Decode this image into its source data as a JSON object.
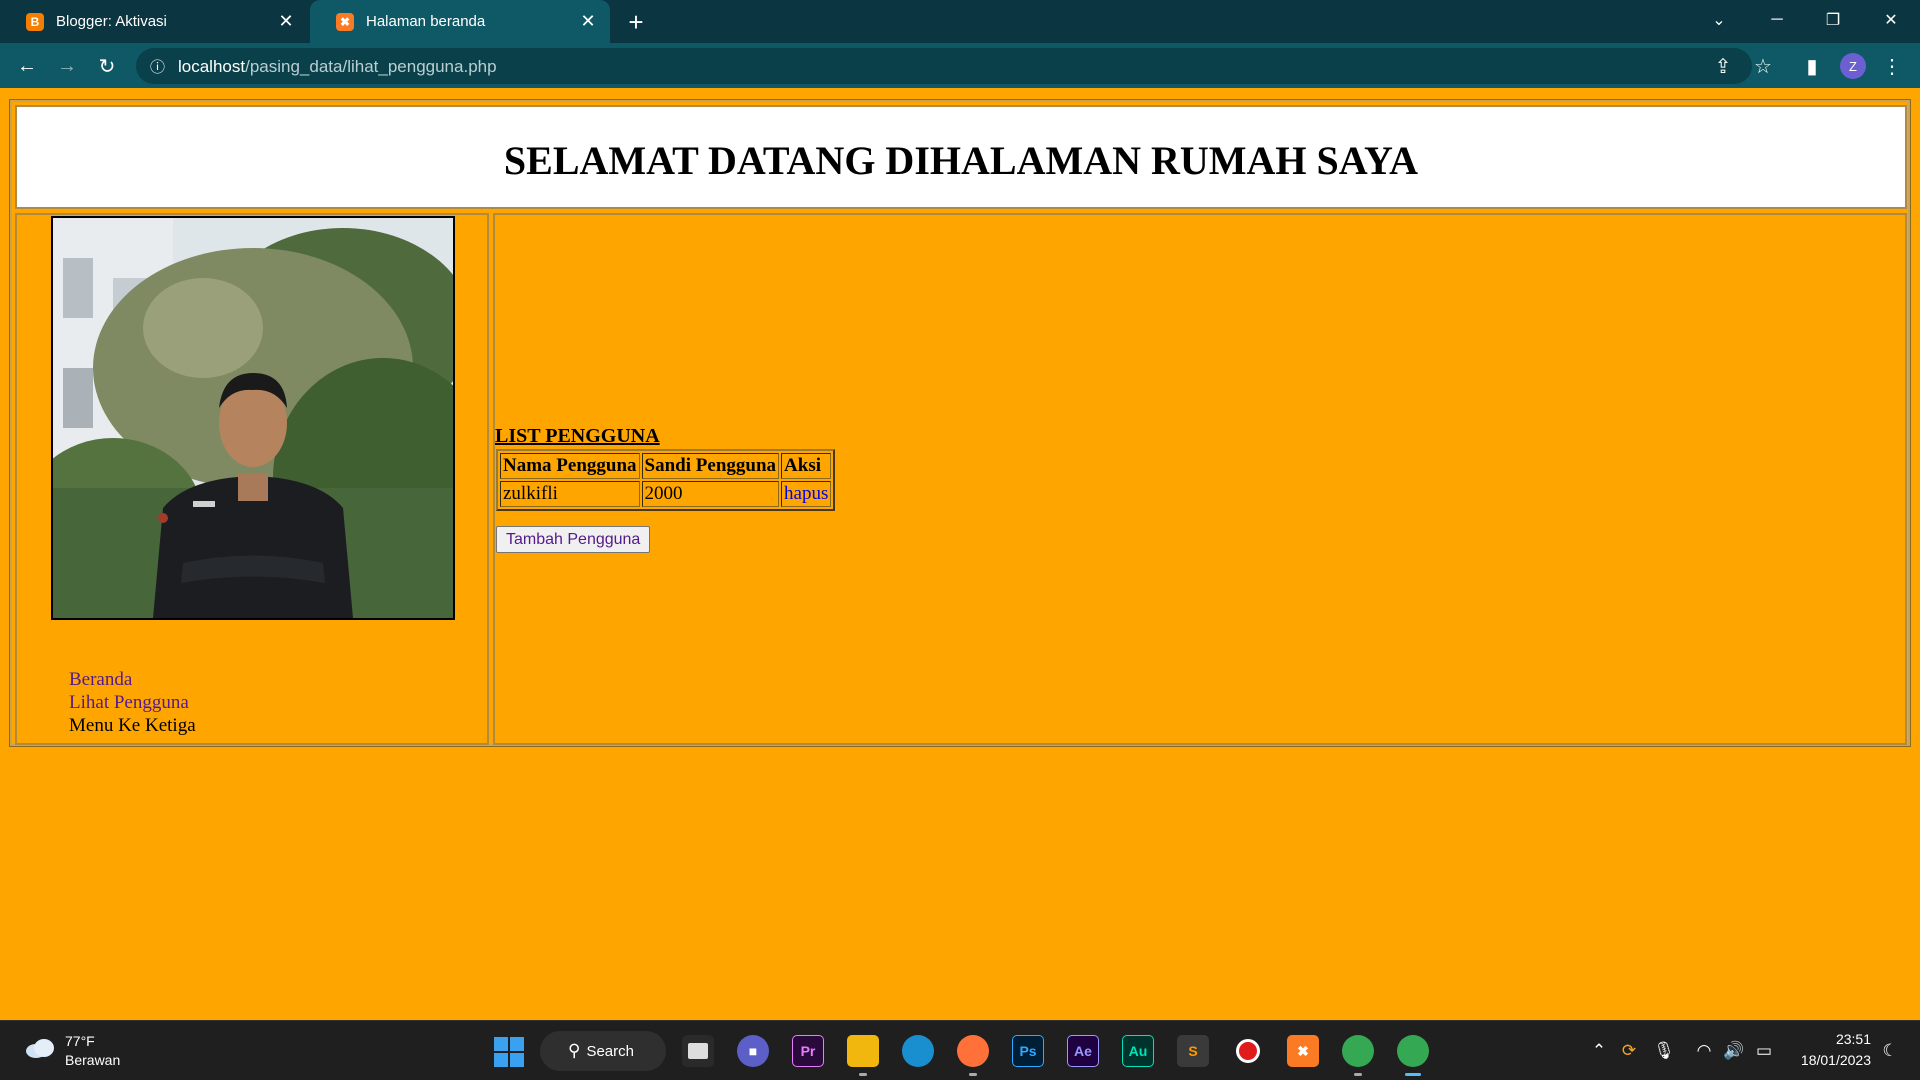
{
  "browser": {
    "tabs": [
      {
        "title": "Blogger: Aktivasi",
        "favicon": "blogger-icon",
        "color": "#f57d00"
      },
      {
        "title": "Halaman beranda",
        "favicon": "xampp-icon",
        "color": "#fb7a24",
        "active": true
      }
    ],
    "address": {
      "host": "localhost",
      "path": "/pasing_data/lihat_pengguna.php"
    },
    "profile_initial": "Z"
  },
  "page": {
    "title": "SELAMAT DATANG DIHALAMAN RUMAH SAYA",
    "background": "#FFA500",
    "menu": [
      {
        "label": "Beranda",
        "link": true
      },
      {
        "label": "Lihat Pengguna",
        "link": true
      },
      {
        "label": "Menu Ke Ketiga",
        "link": false
      }
    ],
    "list_title": "LIST PENGGUNA",
    "table": {
      "headers": [
        "Nama Pengguna",
        "Sandi Pengguna",
        "Aksi"
      ],
      "rows": [
        {
          "nama": "zulkifli",
          "sandi": "2000",
          "aksi": "hapus"
        }
      ]
    },
    "add_button": "Tambah Pengguna"
  },
  "taskbar": {
    "weather_temp": "77°F",
    "weather_desc": "Berawan",
    "search_label": "Search",
    "apps": [
      {
        "name": "task-view",
        "glyph": "",
        "bg": "#2a2a2a"
      },
      {
        "name": "teams-chat",
        "glyph": "",
        "bg": "#5b5fc7"
      },
      {
        "name": "premiere-pro",
        "glyph": "Pr",
        "bg": "#2a0a3a"
      },
      {
        "name": "file-explorer",
        "glyph": "",
        "bg": "#f2b70f"
      },
      {
        "name": "edge",
        "glyph": "",
        "bg": "#1a8fd0"
      },
      {
        "name": "firefox",
        "glyph": "",
        "bg": "#ff7139"
      },
      {
        "name": "photoshop",
        "glyph": "Ps",
        "bg": "#001e36"
      },
      {
        "name": "after-effects",
        "glyph": "Ae",
        "bg": "#1f0040"
      },
      {
        "name": "audition",
        "glyph": "Au",
        "bg": "#00332b"
      },
      {
        "name": "sublime-text",
        "glyph": "S",
        "bg": "#3a3a3a"
      },
      {
        "name": "recorder",
        "glyph": "",
        "bg": "#ffffff"
      },
      {
        "name": "xampp",
        "glyph": "",
        "bg": "#fb7a24"
      },
      {
        "name": "chrome",
        "glyph": "",
        "bg": "#34a853"
      },
      {
        "name": "chrome-active",
        "glyph": "",
        "bg": "#34a853"
      }
    ],
    "time": "23:51",
    "date": "18/01/2023"
  }
}
